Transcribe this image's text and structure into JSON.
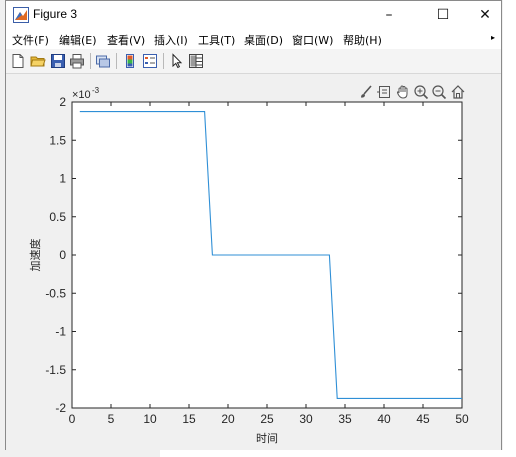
{
  "window": {
    "title": "Figure 3",
    "controls": {
      "minimize": "–",
      "maximize": "☐",
      "close": "✕"
    }
  },
  "menu": {
    "items": [
      "文件(F)",
      "编辑(E)",
      "查看(V)",
      "插入(I)",
      "工具(T)",
      "桌面(D)",
      "窗口(W)",
      "帮助(H)"
    ],
    "overflow_arrow": "▸"
  },
  "toolbar": {
    "icons": [
      "new-figure-icon",
      "open-file-icon",
      "save-icon",
      "print-icon",
      "link-plot-icon",
      "insert-colorbar-icon",
      "insert-legend-icon",
      "edit-plot-icon",
      "property-inspector-icon"
    ]
  },
  "axes_toolbar": {
    "icons": [
      "brush-icon",
      "data-tips-icon",
      "pan-hand-icon",
      "zoom-in-icon",
      "zoom-out-icon",
      "restore-view-icon"
    ]
  },
  "chart_data": {
    "type": "line",
    "title": "",
    "xlabel": "时间",
    "ylabel": "加速度",
    "y_exponent_label": "×10",
    "y_exponent": "-3",
    "xlim": [
      0,
      50
    ],
    "ylim": [
      -2,
      2
    ],
    "xticks": [
      0,
      5,
      10,
      15,
      20,
      25,
      30,
      35,
      40,
      45,
      50
    ],
    "xtick_labels": [
      "0",
      "5",
      "10",
      "15",
      "20",
      "25",
      "30",
      "35",
      "40",
      "45",
      "50"
    ],
    "yticks": [
      2,
      1.5,
      1,
      0.5,
      0,
      -0.5,
      -1,
      -1.5,
      -2
    ],
    "ytick_labels": [
      "2",
      "1.5",
      "1",
      "0.5",
      "0",
      "-0.5",
      "-1",
      "-1.5",
      "-2"
    ],
    "grid": false,
    "line_color": "#2f8fd6",
    "series": [
      {
        "x": [
          1,
          17,
          18,
          33,
          34,
          50
        ],
        "y": [
          1.875,
          1.875,
          0,
          0,
          -1.875,
          -1.875
        ]
      }
    ]
  }
}
